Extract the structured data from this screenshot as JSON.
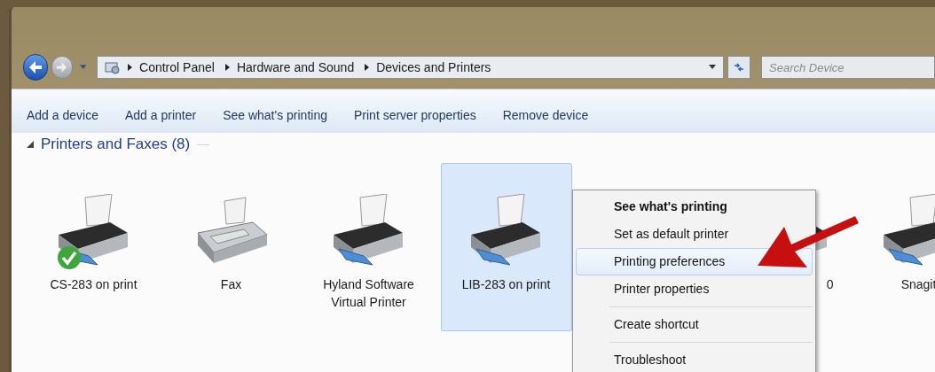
{
  "navigation": {
    "back_enabled": true,
    "forward_enabled": false
  },
  "address_bar": {
    "breadcrumbs": [
      "Control Panel",
      "Hardware and Sound",
      "Devices and Printers"
    ]
  },
  "search": {
    "placeholder": "Search Device"
  },
  "toolbar": [
    "Add a device",
    "Add a printer",
    "See what's printing",
    "Print server properties",
    "Remove device"
  ],
  "group": {
    "title": "Printers and Faxes (8)",
    "expanded": true
  },
  "devices": [
    {
      "kind": "printer",
      "label": "CS-283 on print",
      "default": true,
      "selected": false,
      "covered": false
    },
    {
      "kind": "fax",
      "label": "Fax",
      "default": false,
      "selected": false,
      "covered": false
    },
    {
      "kind": "printer",
      "label": "Hyland Software\nVirtual Printer",
      "default": false,
      "selected": false,
      "covered": false
    },
    {
      "kind": "printer",
      "label": "LIB-283 on print",
      "default": false,
      "selected": true,
      "covered": false
    },
    {
      "kind": "hidden"
    },
    {
      "kind": "printer",
      "label": "0",
      "default": false,
      "selected": false,
      "covered": true
    },
    {
      "kind": "printer",
      "label": "Snagit",
      "default": false,
      "selected": false,
      "covered": false
    }
  ],
  "context_menu": [
    {
      "kind": "item",
      "label": "See what's printing",
      "default": true,
      "selected": false
    },
    {
      "kind": "item",
      "label": "Set as default printer",
      "default": false,
      "selected": false
    },
    {
      "kind": "item",
      "label": "Printing preferences",
      "default": false,
      "selected": true
    },
    {
      "kind": "item",
      "label": "Printer properties",
      "default": false,
      "selected": false
    },
    {
      "kind": "separator"
    },
    {
      "kind": "item",
      "label": "Create shortcut",
      "default": false,
      "selected": false
    },
    {
      "kind": "separator"
    },
    {
      "kind": "item",
      "label": "Troubleshoot",
      "default": false,
      "selected": false
    }
  ]
}
